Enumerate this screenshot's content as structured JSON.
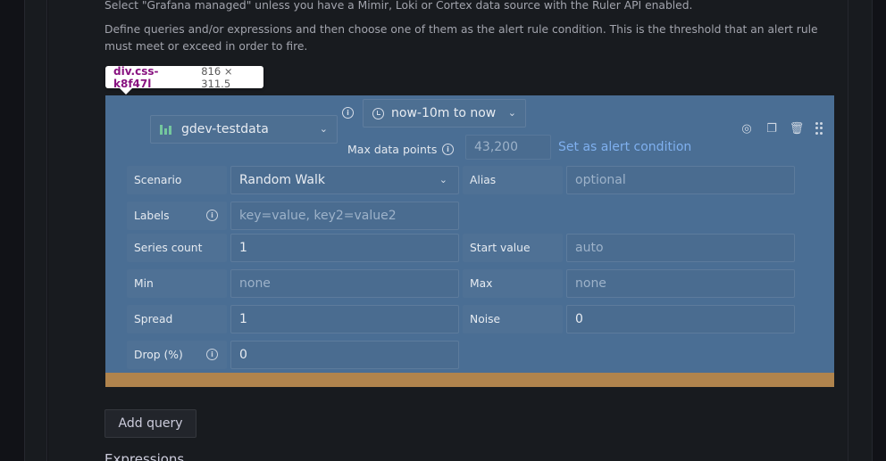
{
  "help": {
    "line1": "Select \"Grafana managed\" unless you have a Mimir, Loki or Cortex data source with the Ruler API enabled.",
    "line2": "Define queries and/or expressions and then choose one of them as the alert rule condition. This is the threshold that an alert rule must meet or exceed in order to fire."
  },
  "tooltip": {
    "tag": "div.css-k8f47l",
    "size": "816 × 311.5"
  },
  "query": {
    "datasource": "gdev-testdata",
    "time_range": "now-10m to now",
    "max_data_points_label": "Max data points",
    "max_data_points_placeholder": "43,200",
    "set_alert_condition": "Set as alert condition"
  },
  "form": {
    "scenario_label": "Scenario",
    "scenario_value": "Random Walk",
    "alias_label": "Alias",
    "alias_placeholder": "optional",
    "labels_label": "Labels",
    "labels_placeholder": "key=value, key2=value2",
    "series_count_label": "Series count",
    "series_count_value": "1",
    "start_value_label": "Start value",
    "start_value_placeholder": "auto",
    "min_label": "Min",
    "min_placeholder": "none",
    "max_label": "Max",
    "max_placeholder": "none",
    "spread_label": "Spread",
    "spread_value": "1",
    "noise_label": "Noise",
    "noise_value": "0",
    "drop_label": "Drop (%)",
    "drop_value": "0"
  },
  "add_query_label": "Add query",
  "expressions_title": "Expressions",
  "colors": {
    "highlight": "#4a6e94",
    "link": "#7fb0ef",
    "strip": "#b0844d"
  }
}
